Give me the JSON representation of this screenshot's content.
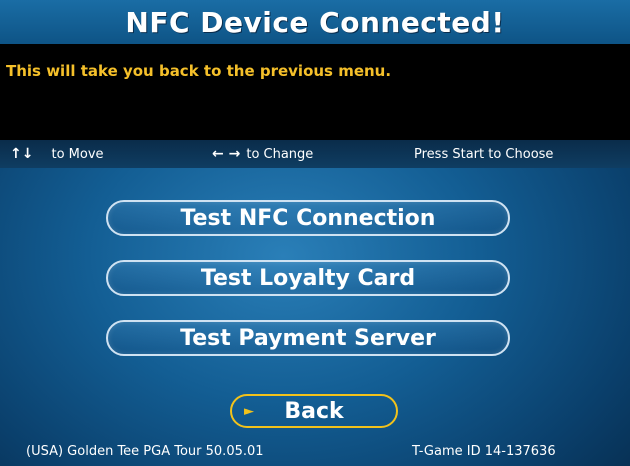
{
  "header": {
    "title": "NFC Device Connected!"
  },
  "description": {
    "text": "This will take you back to the previous menu."
  },
  "hints": {
    "move": {
      "glyph": "↑↓",
      "label": "to Move"
    },
    "change": {
      "glyph": "← →",
      "label": "to Change"
    },
    "choose": {
      "label": "Press Start to Choose"
    }
  },
  "menu": {
    "items": [
      {
        "label": "Test NFC Connection"
      },
      {
        "label": "Test Loyalty Card"
      },
      {
        "label": "Test Payment Server"
      }
    ],
    "back": {
      "label": "Back",
      "selected": true
    }
  },
  "footer": {
    "version": "(USA) Golden Tee PGA Tour 50.05.01",
    "game_id": "T-Game ID 14-137636"
  },
  "colors": {
    "accent": "#f2c21b",
    "description_text": "#f5c02a",
    "background": "#135e94"
  }
}
